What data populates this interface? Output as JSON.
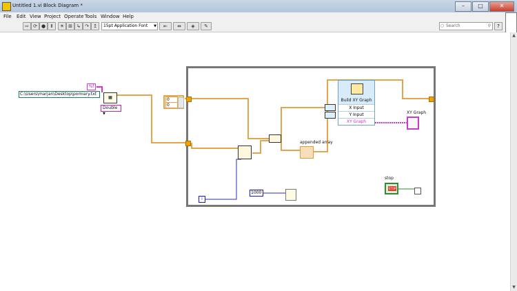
{
  "window": {
    "title": "Untitled 1.vi Block Diagram *",
    "minimize": "–",
    "maximize": "□",
    "close": "✕"
  },
  "menu": [
    "File",
    "Edit",
    "View",
    "Project",
    "Operate",
    "Tools",
    "Window",
    "Help"
  ],
  "toolbar": {
    "font_selector": "15pt Application Font",
    "search_placeholder": "Search",
    "help": "?"
  },
  "diagram": {
    "file_path": "C:\\Users\\marjan\\Desktop\\pomiary.txt",
    "format_string": "%f",
    "type_selector": "Double",
    "initial_array": [
      "0",
      "0"
    ],
    "wait_ms": "1000",
    "iteration_label": "i",
    "build_xy_graph": {
      "title": "Build XY Graph",
      "x_input": "X Input",
      "y_input": "Y Input",
      "output": "XY Graph"
    },
    "xy_graph_label": "XY Graph",
    "appended_array_label": "appended array",
    "stop_label": "stop",
    "stop_button_text": "STOP"
  },
  "colors": {
    "orange_wire": "#E6A54A",
    "blue_wire": "#2B2BB4",
    "pink_wire": "#D633D6",
    "green_wire": "#2E8B2E",
    "teal_path": "#1A7A6A"
  }
}
